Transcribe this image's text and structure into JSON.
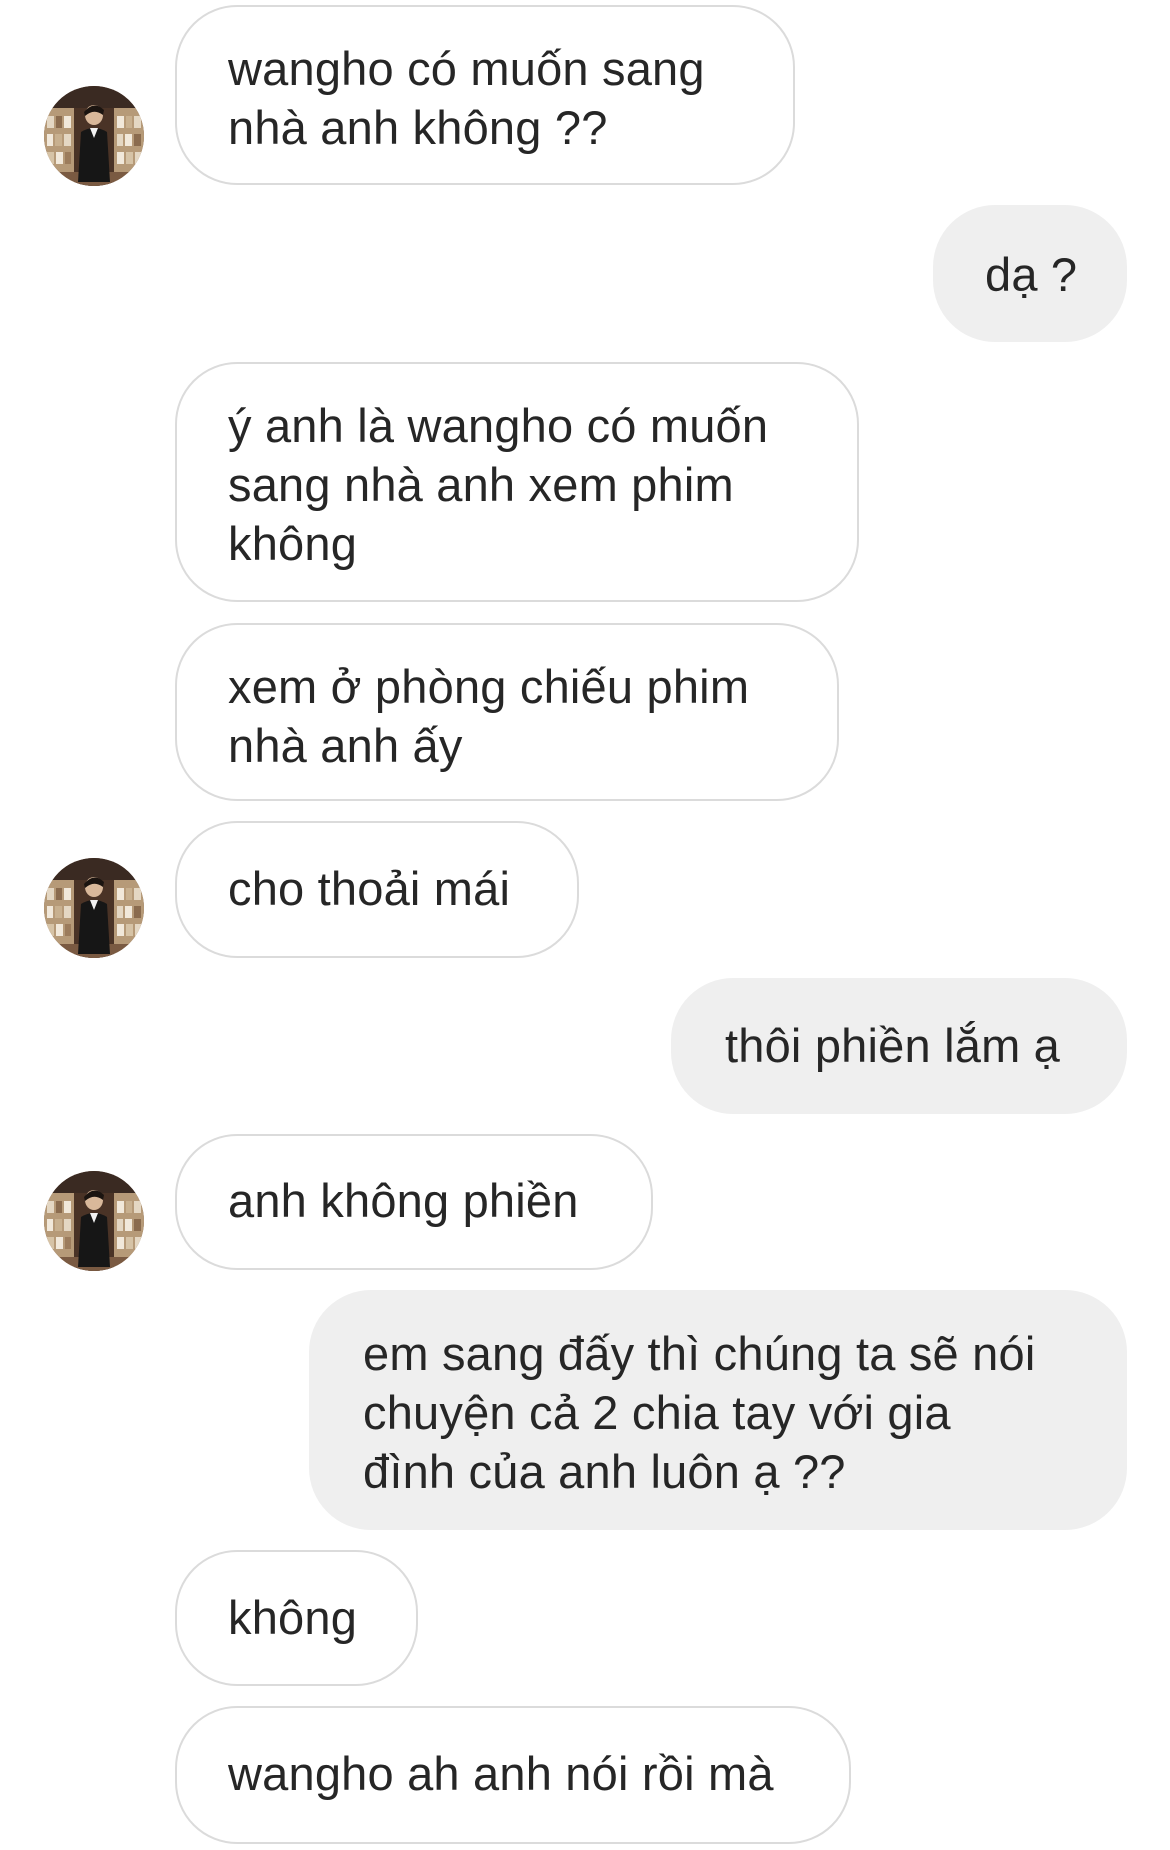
{
  "conversation": {
    "messages": [
      {
        "sender": "other",
        "lines": [
          "wangho có muốn sang",
          "nhà anh không ??"
        ]
      },
      {
        "sender": "me",
        "lines": [
          "dạ ?"
        ]
      },
      {
        "sender": "other",
        "lines": [
          "ý anh là wangho có muốn",
          "sang nhà anh xem phim",
          "không"
        ]
      },
      {
        "sender": "other",
        "lines": [
          "xem ở phòng chiếu phim",
          "nhà anh ấy"
        ]
      },
      {
        "sender": "other",
        "lines": [
          "cho thoải mái"
        ]
      },
      {
        "sender": "me",
        "lines": [
          "thôi phiền lắm ạ"
        ]
      },
      {
        "sender": "other",
        "lines": [
          "anh không phiền"
        ]
      },
      {
        "sender": "me",
        "lines": [
          "em sang đấy thì chúng ta sẽ nói",
          "chuyện cả 2 chia tay với gia",
          "đình của anh luôn ạ ??"
        ]
      },
      {
        "sender": "other",
        "lines": [
          "không"
        ]
      },
      {
        "sender": "other",
        "lines": [
          "wangho ah anh nói rồi mà"
        ]
      }
    ]
  },
  "colors": {
    "incoming_bubble_bg": "#ffffff",
    "incoming_bubble_border": "#dbdbdb",
    "outgoing_bubble_bg": "#efefef",
    "text": "#262626"
  },
  "icons": {
    "avatar": "contact-avatar-photo"
  }
}
